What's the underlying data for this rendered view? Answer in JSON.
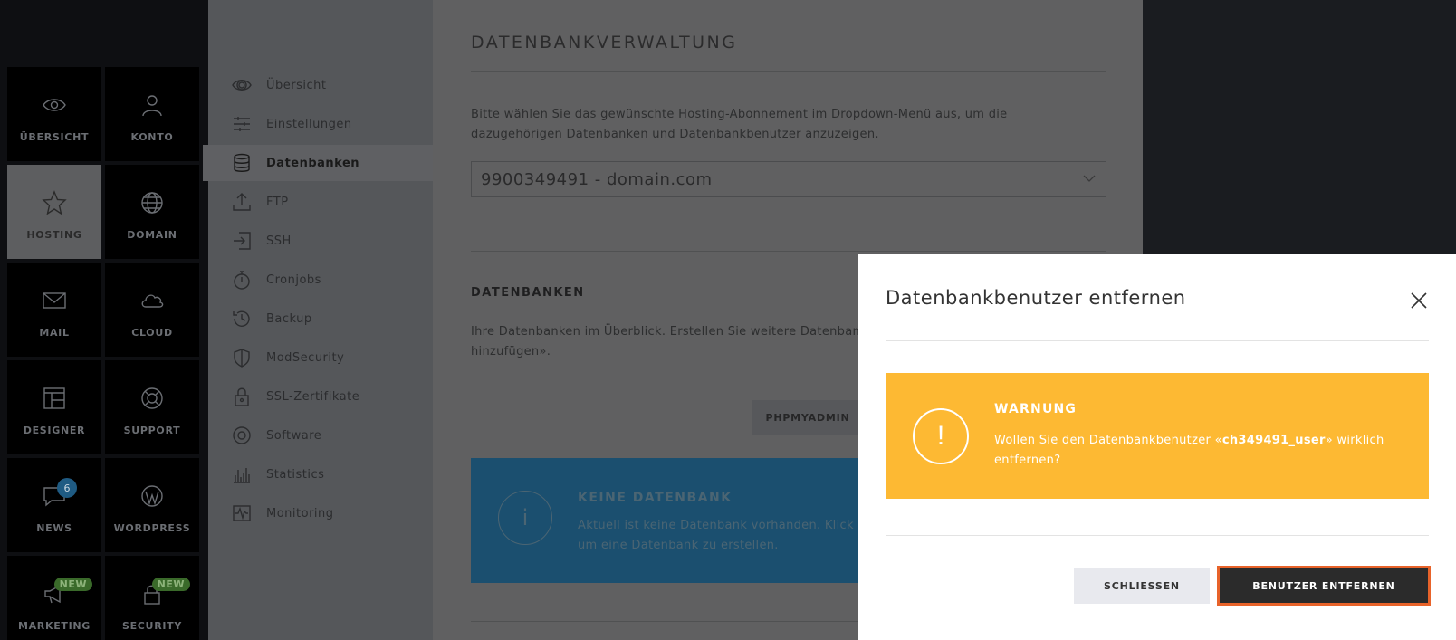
{
  "tiles": [
    {
      "label": "ÜBERSICHT",
      "icon": "eye-icon"
    },
    {
      "label": "KONTO",
      "icon": "user-icon"
    },
    {
      "label": "HOSTING",
      "icon": "star-icon",
      "active": true
    },
    {
      "label": "DOMAIN",
      "icon": "globe-icon"
    },
    {
      "label": "MAIL",
      "icon": "envelope-icon"
    },
    {
      "label": "CLOUD",
      "icon": "cloud-icon"
    },
    {
      "label": "DESIGNER",
      "icon": "layout-icon"
    },
    {
      "label": "SUPPORT",
      "icon": "lifebuoy-icon"
    },
    {
      "label": "NEWS",
      "icon": "chat-icon",
      "badge": "6"
    },
    {
      "label": "WORDPRESS",
      "icon": "wordpress-icon"
    },
    {
      "label": "MARKETING",
      "icon": "megaphone-icon",
      "new": "NEW"
    },
    {
      "label": "SECURITY",
      "icon": "lock-icon",
      "new": "NEW"
    }
  ],
  "subnav": [
    {
      "label": "Übersicht",
      "icon": "eye-icon"
    },
    {
      "label": "Einstellungen",
      "icon": "sliders-icon"
    },
    {
      "label": "Datenbanken",
      "icon": "database-icon",
      "active": true
    },
    {
      "label": "FTP",
      "icon": "upload-icon"
    },
    {
      "label": "SSH",
      "icon": "login-icon"
    },
    {
      "label": "Cronjobs",
      "icon": "stopwatch-icon"
    },
    {
      "label": "Backup",
      "icon": "history-icon"
    },
    {
      "label": "ModSecurity",
      "icon": "shield-icon"
    },
    {
      "label": "SSL-Zertifikate",
      "icon": "padlock-icon"
    },
    {
      "label": "Software",
      "icon": "disc-icon"
    },
    {
      "label": "Statistics",
      "icon": "bar-chart-icon"
    },
    {
      "label": "Monitoring",
      "icon": "pulse-icon"
    }
  ],
  "main": {
    "title": "DATENBANKVERWALTUNG",
    "intro": "Bitte wählen Sie das gewünschte Hosting-Abonnement im Dropdown-Menü aus, um die dazugehörigen Datenbanken und Datenbankbenutzer anzuzeigen.",
    "select_value": "9900349491 - domain.com",
    "section_title": "DATENBANKEN",
    "section_text": "Ihre Datenbanken im Überblick. Erstellen Sie weitere Datenban hinzufügen».",
    "pma_button": "PHPMYADMIN",
    "info_title": "KEINE DATENBANK",
    "info_text": "Aktuell ist keine Datenbank vorhanden. Klick um eine Datenbank zu erstellen."
  },
  "modal": {
    "title": "Datenbankbenutzer entfernen",
    "warning_title": "WARNUNG",
    "warning_text_before": "Wollen Sie den Datenbankbenutzer «",
    "warning_user": "ch349491_user",
    "warning_text_after": "» wirklich entfernen?",
    "close_button": "SCHLIESSEN",
    "remove_button": "BENUTZER ENTFERNEN"
  },
  "colors": {
    "warning": "#fdb933",
    "info": "#1b4f6f",
    "accent_outline": "#e8632a"
  }
}
